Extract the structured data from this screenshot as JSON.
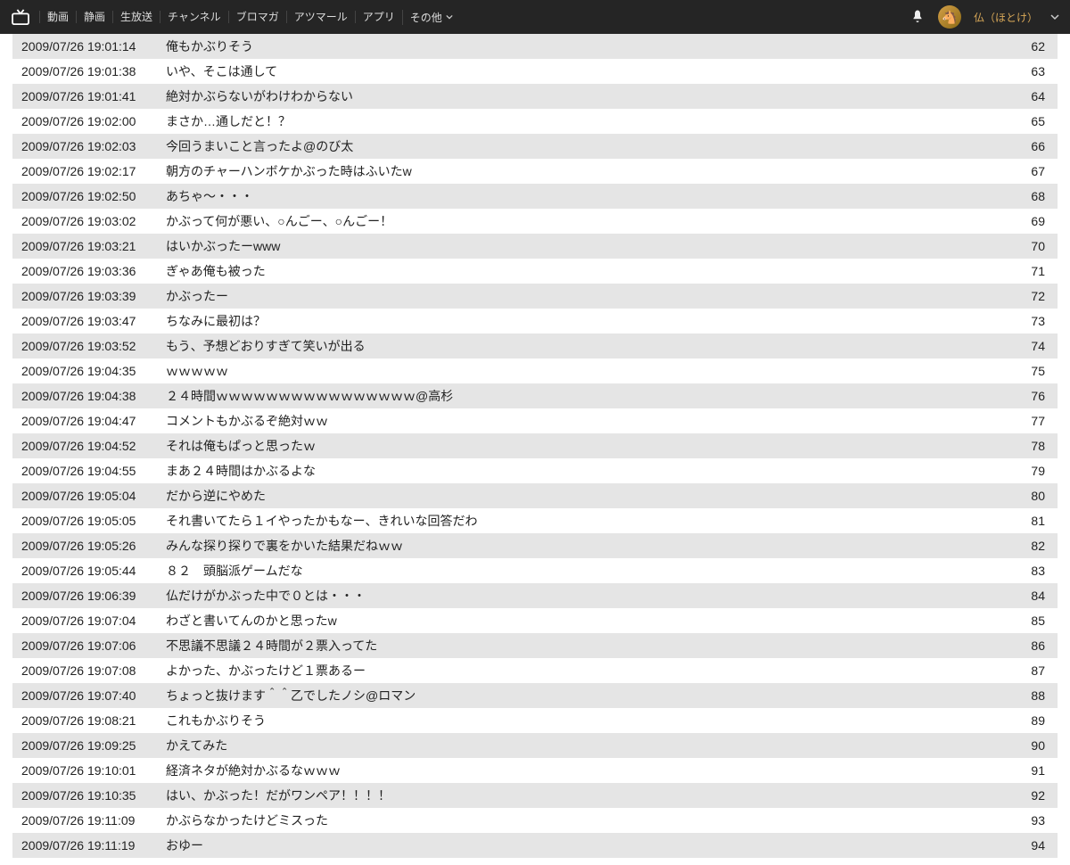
{
  "topbar": {
    "nav": [
      "動画",
      "静画",
      "生放送",
      "チャンネル",
      "ブロマガ",
      "アツマール",
      "アプリ"
    ],
    "other": "その他",
    "username": "仏（ほとけ）"
  },
  "rows": [
    {
      "time": "2009/07/26 19:01:14",
      "text": "俺もかぶりそう",
      "num": "62"
    },
    {
      "time": "2009/07/26 19:01:38",
      "text": "いや、そこは通して",
      "num": "63"
    },
    {
      "time": "2009/07/26 19:01:41",
      "text": "絶対かぶらないがわけわからない",
      "num": "64"
    },
    {
      "time": "2009/07/26 19:02:00",
      "text": "まさか…通しだと！？",
      "num": "65"
    },
    {
      "time": "2009/07/26 19:02:03",
      "text": "今回うまいこと言ったよ@のび太",
      "num": "66"
    },
    {
      "time": "2009/07/26 19:02:17",
      "text": "朝方のチャーハンボケかぶった時はふいたw",
      "num": "67"
    },
    {
      "time": "2009/07/26 19:02:50",
      "text": "あちゃ〜・・・",
      "num": "68"
    },
    {
      "time": "2009/07/26 19:03:02",
      "text": "かぶって何が悪い、○んごー、○んごー！",
      "num": "69"
    },
    {
      "time": "2009/07/26 19:03:21",
      "text": "はいかぶったーwww",
      "num": "70"
    },
    {
      "time": "2009/07/26 19:03:36",
      "text": "ぎゃあ俺も被った",
      "num": "71"
    },
    {
      "time": "2009/07/26 19:03:39",
      "text": "かぶったー",
      "num": "72"
    },
    {
      "time": "2009/07/26 19:03:47",
      "text": "ちなみに最初は？",
      "num": "73"
    },
    {
      "time": "2009/07/26 19:03:52",
      "text": "もう、予想どおりすぎて笑いが出る",
      "num": "74"
    },
    {
      "time": "2009/07/26 19:04:35",
      "text": "ｗｗｗｗｗ",
      "num": "75"
    },
    {
      "time": "2009/07/26 19:04:38",
      "text": "２４時間ｗｗｗｗｗｗｗｗｗｗｗｗｗｗｗｗ@高杉",
      "num": "76"
    },
    {
      "time": "2009/07/26 19:04:47",
      "text": "コメントもかぶるぞ絶対ｗｗ",
      "num": "77"
    },
    {
      "time": "2009/07/26 19:04:52",
      "text": "それは俺もぱっと思ったｗ",
      "num": "78"
    },
    {
      "time": "2009/07/26 19:04:55",
      "text": "まあ２４時間はかぶるよな",
      "num": "79"
    },
    {
      "time": "2009/07/26 19:05:04",
      "text": "だから逆にやめた",
      "num": "80"
    },
    {
      "time": "2009/07/26 19:05:05",
      "text": "それ書いてたら１イやったかもなー、きれいな回答だわ",
      "num": "81"
    },
    {
      "time": "2009/07/26 19:05:26",
      "text": "みんな探り探りで裏をかいた結果だねｗｗ",
      "num": "82"
    },
    {
      "time": "2009/07/26 19:05:44",
      "text": "８２　頭脳派ゲームだな",
      "num": "83"
    },
    {
      "time": "2009/07/26 19:06:39",
      "text": "仏だけがかぶった中で０とは・・・",
      "num": "84"
    },
    {
      "time": "2009/07/26 19:07:04",
      "text": "わざと書いてんのかと思ったw",
      "num": "85"
    },
    {
      "time": "2009/07/26 19:07:06",
      "text": "不思議不思議２４時間が２票入ってた",
      "num": "86"
    },
    {
      "time": "2009/07/26 19:07:08",
      "text": "よかった、かぶったけど１票あるー",
      "num": "87"
    },
    {
      "time": "2009/07/26 19:07:40",
      "text": "ちょっと抜けます＾＾乙でしたノシ@ロマン",
      "num": "88"
    },
    {
      "time": "2009/07/26 19:08:21",
      "text": "これもかぶりそう",
      "num": "89"
    },
    {
      "time": "2009/07/26 19:09:25",
      "text": "かえてみた",
      "num": "90"
    },
    {
      "time": "2009/07/26 19:10:01",
      "text": "経済ネタが絶対かぶるなｗｗｗ",
      "num": "91"
    },
    {
      "time": "2009/07/26 19:10:35",
      "text": "はい、かぶった！だがワンペア！！！！",
      "num": "92"
    },
    {
      "time": "2009/07/26 19:11:09",
      "text": "かぶらなかったけどミスった",
      "num": "93"
    },
    {
      "time": "2009/07/26 19:11:19",
      "text": "おゆー",
      "num": "94"
    }
  ]
}
